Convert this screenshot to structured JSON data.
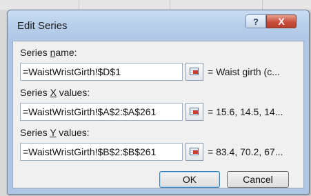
{
  "dialog": {
    "title": "Edit Series",
    "help_label": "?",
    "close_label": "X"
  },
  "series_name": {
    "label_before": "Series ",
    "label_underlined": "n",
    "label_after": "ame:",
    "value": "=WaistWristGirth!$D$1",
    "preview": "= Waist girth (c..."
  },
  "series_x": {
    "label_before": "Series ",
    "label_underlined": "X",
    "label_after": " values:",
    "value": "=WaistWristGirth!$A$2:$A$261",
    "preview": "= 15.6, 14.5, 14..."
  },
  "series_y": {
    "label_before": "Series ",
    "label_underlined": "Y",
    "label_after": " values:",
    "value": "=WaistWristGirth!$B$2:$B$261",
    "preview": "= 83.4, 70.2, 67..."
  },
  "buttons": {
    "ok": "OK",
    "cancel": "Cancel"
  },
  "icons": {
    "help": "help-icon",
    "close": "close-icon",
    "range_select": "range-select-icon"
  }
}
